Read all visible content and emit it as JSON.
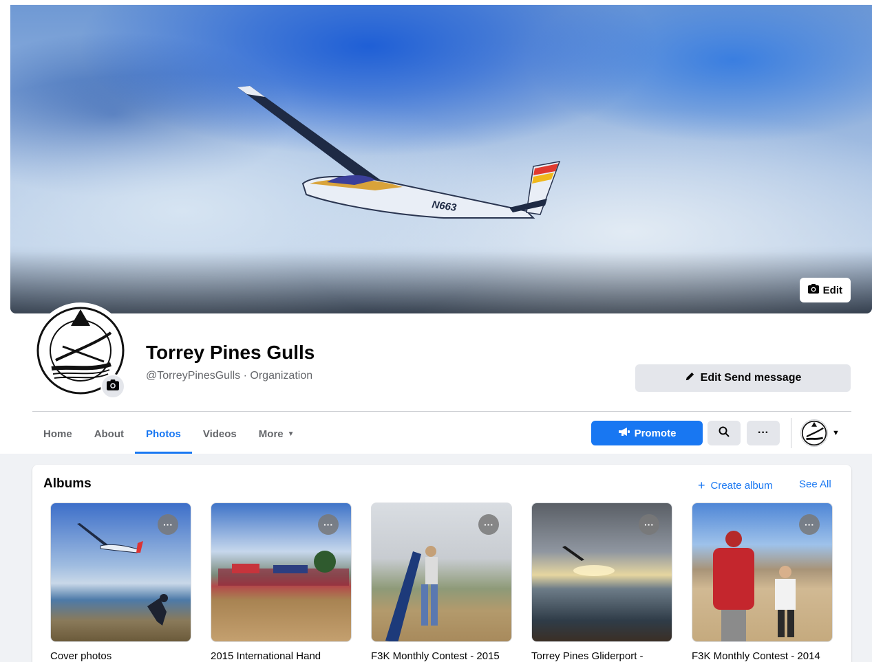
{
  "cover": {
    "edit_label": "Edit"
  },
  "page": {
    "name": "Torrey Pines Gulls",
    "subtitle": "@TorreyPinesGulls · Organization",
    "edit_send_label": "Edit Send message"
  },
  "tabs": [
    {
      "label": "Home",
      "active": false
    },
    {
      "label": "About",
      "active": false
    },
    {
      "label": "Photos",
      "active": true
    },
    {
      "label": "Videos",
      "active": false
    },
    {
      "label": "More",
      "active": false
    }
  ],
  "actions": {
    "promote_label": "Promote",
    "search_icon": "search-icon",
    "more_icon": "ellipsis-icon"
  },
  "albums": {
    "title": "Albums",
    "create_label": "Create album",
    "see_all_label": "See All",
    "items": [
      {
        "name": "Cover photos"
      },
      {
        "name": "2015 International Hand"
      },
      {
        "name": "F3K Monthly Contest - 2015"
      },
      {
        "name": "Torrey Pines Gliderport -"
      },
      {
        "name": "F3K Monthly Contest - 2014"
      }
    ]
  },
  "colors": {
    "accent": "#1877f2",
    "button_grey": "#e4e6eb",
    "text_secondary": "#65676b"
  }
}
